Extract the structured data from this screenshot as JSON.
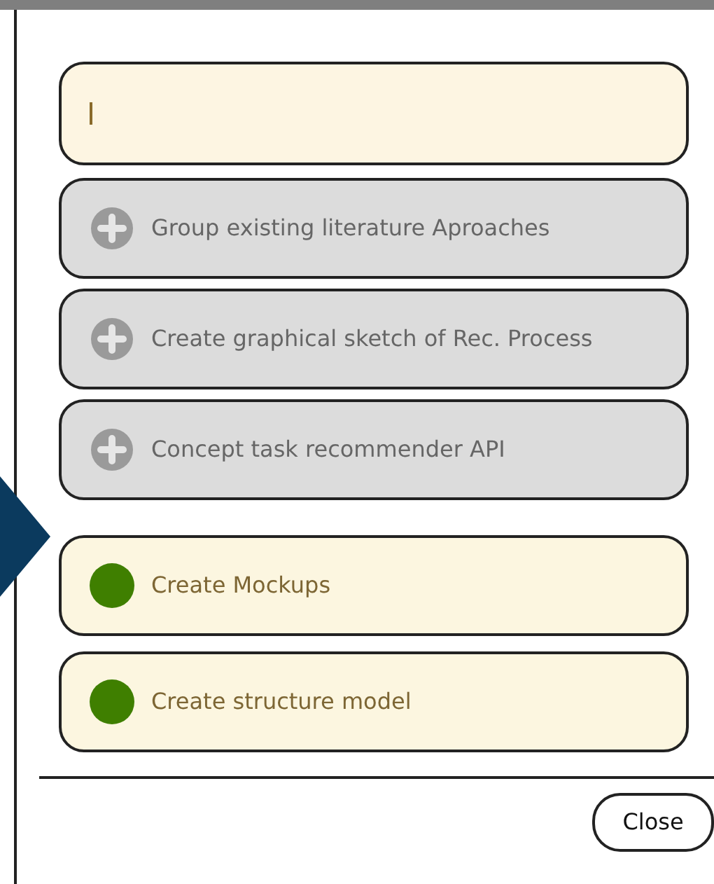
{
  "input": {
    "focused": true
  },
  "items": [
    {
      "kind": "suggestion",
      "label": "Group existing literature Aproaches"
    },
    {
      "kind": "suggestion",
      "label": "Create graphical sketch of Rec. Process"
    },
    {
      "kind": "suggestion",
      "label": "Concept task recommender API"
    },
    {
      "kind": "task",
      "label": "Create Mockups",
      "color": "#3f7f00"
    },
    {
      "kind": "task",
      "label": "Create structure model",
      "color": "#3f7f00"
    }
  ],
  "close_button": "Close"
}
